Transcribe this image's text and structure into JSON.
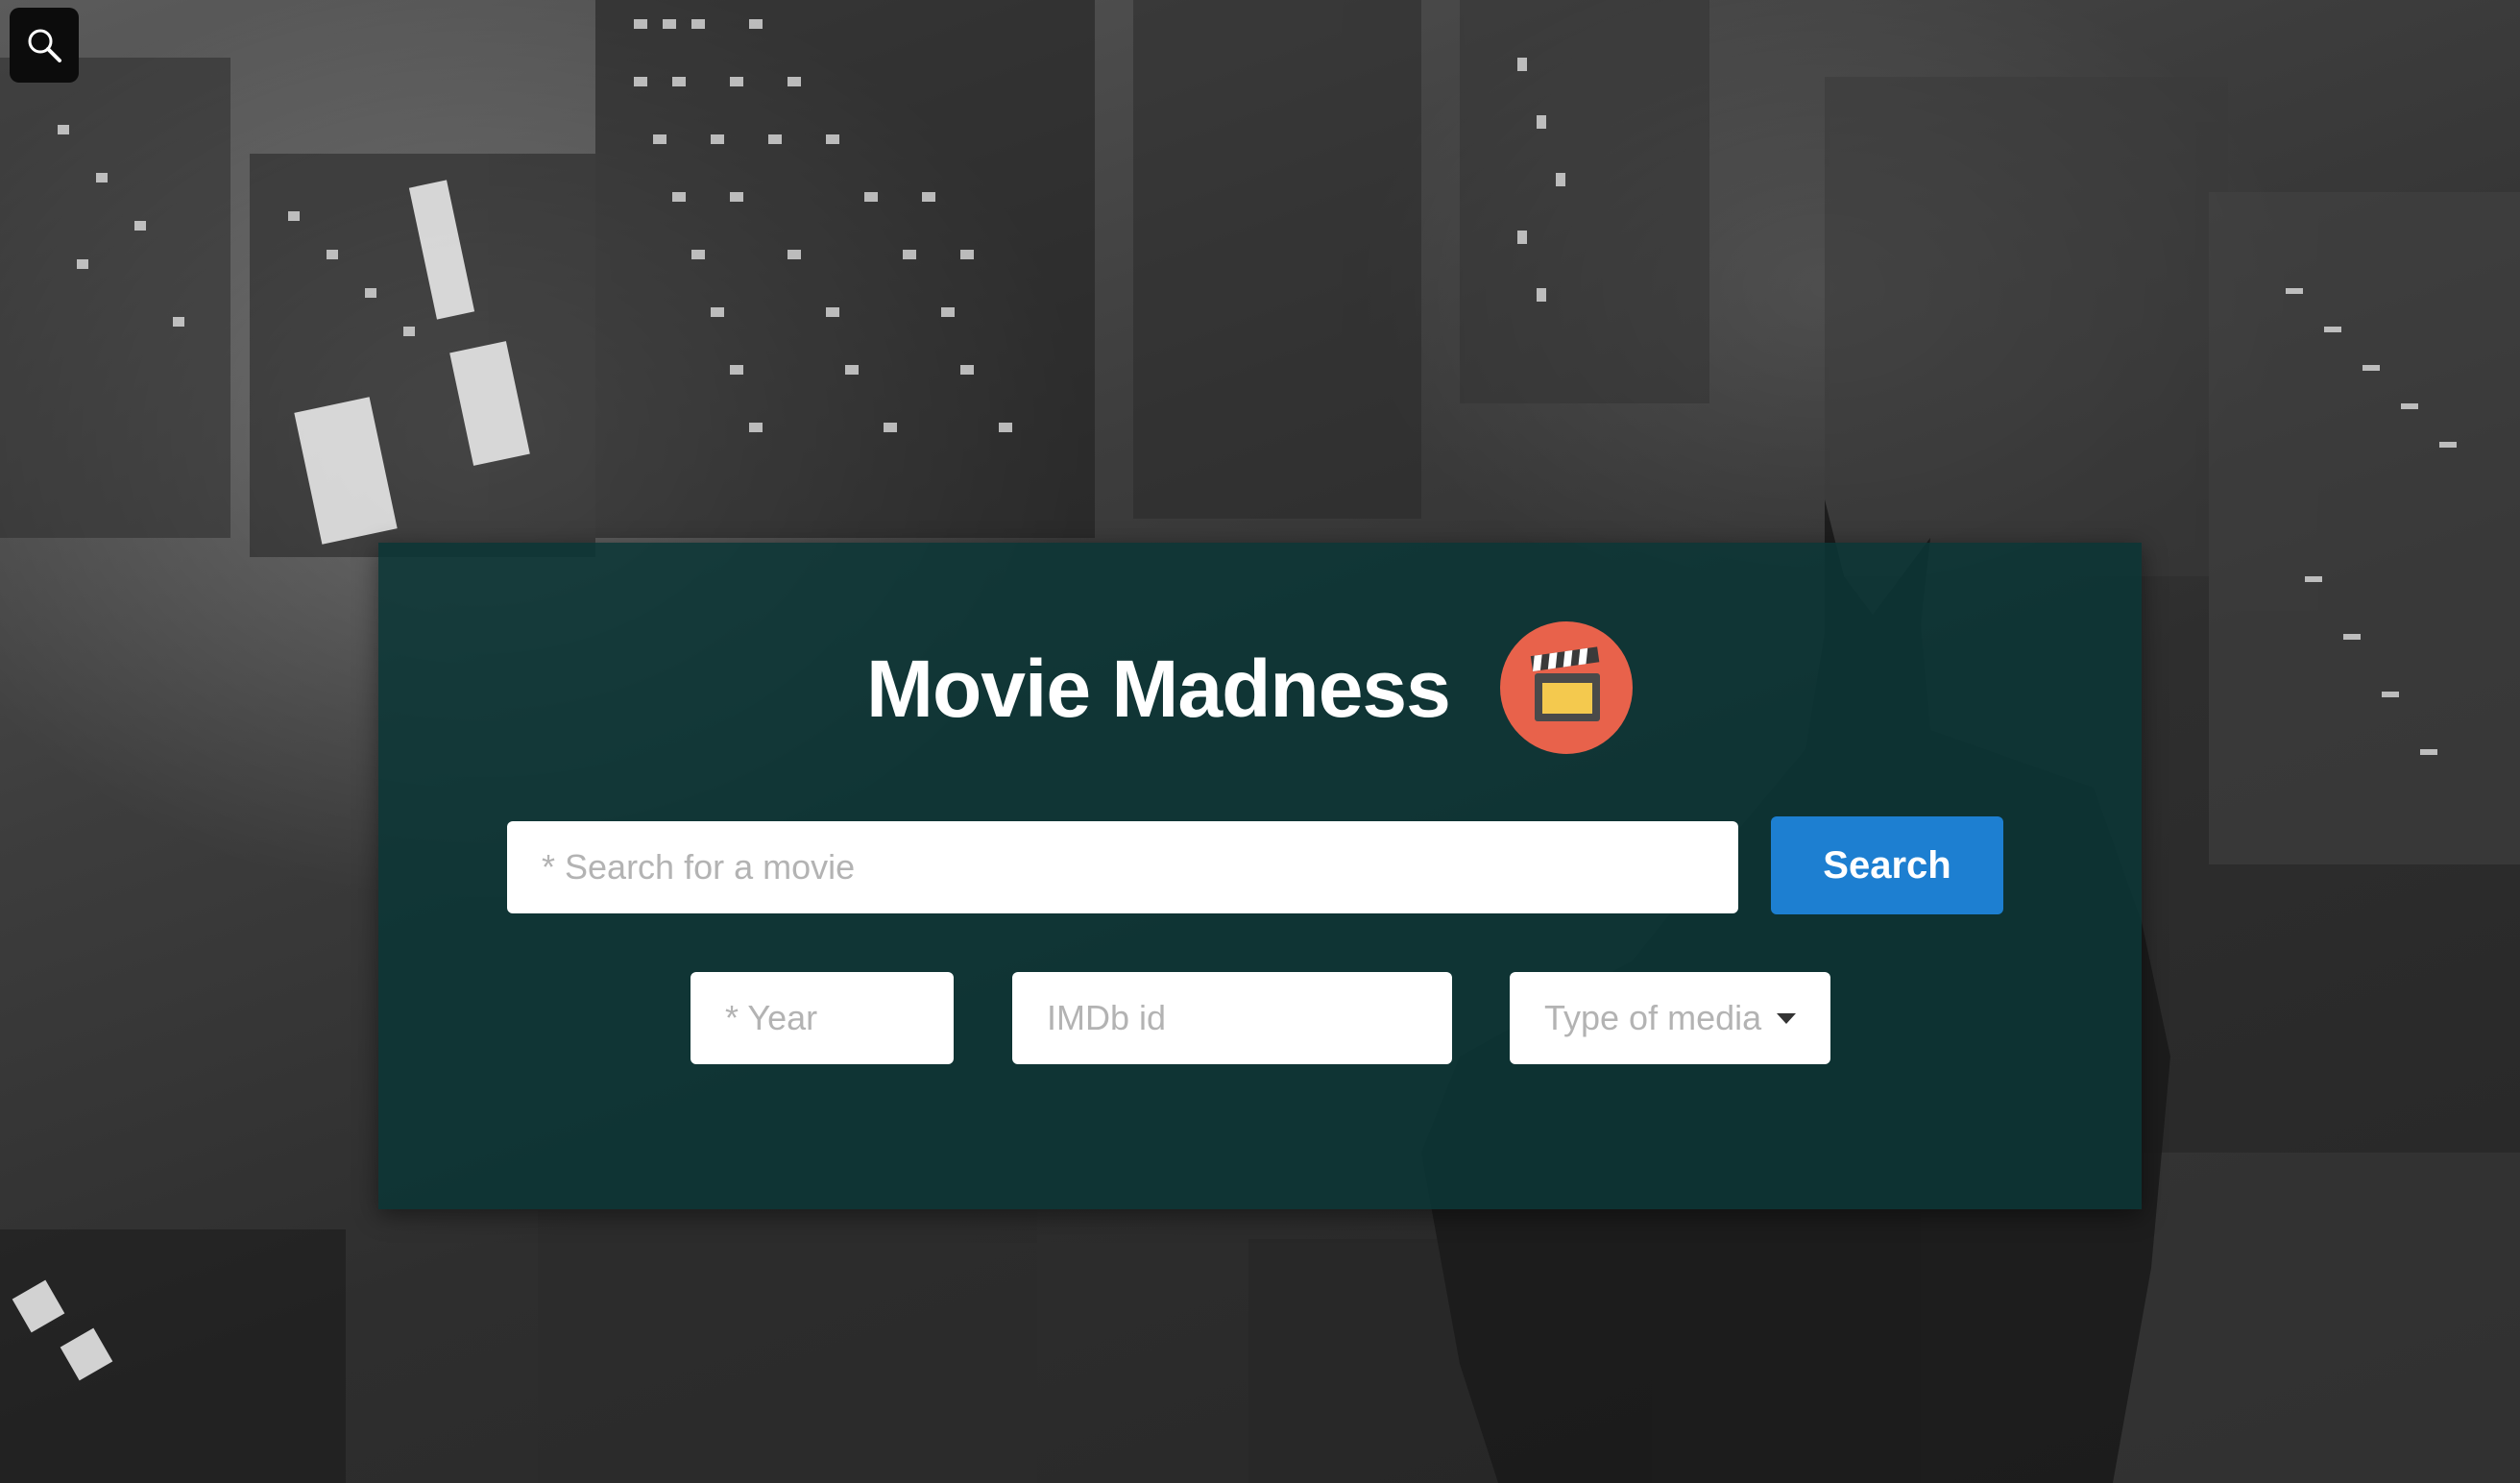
{
  "header": {
    "title": "Movie Madness",
    "logo_icon": "clapperboard-icon",
    "corner_icon": "search-icon"
  },
  "search": {
    "placeholder": "* Search for a movie",
    "button_label": "Search"
  },
  "filters": {
    "year_placeholder": "* Year",
    "imdb_placeholder": "IMDb id",
    "media_type_label": "Type of media"
  },
  "colors": {
    "panel": "#0a3636",
    "button": "#1d7fd1",
    "logo": "#e8624b"
  }
}
